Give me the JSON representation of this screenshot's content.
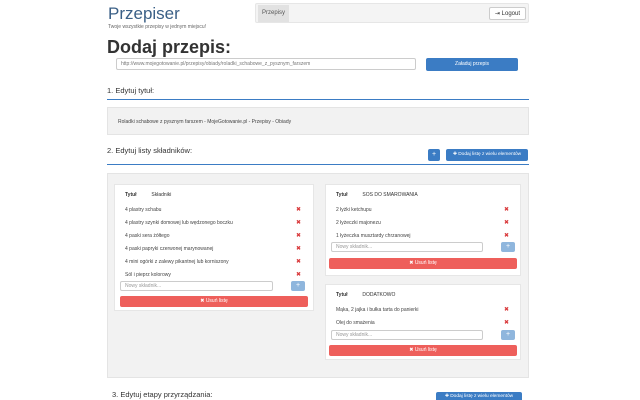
{
  "brand": {
    "title": "Przepiser",
    "subtitle": "Twoje wszystkie przepisy w jednym miejscu!"
  },
  "nav": {
    "tab_label": "Przepisy",
    "logout_label": "Logout"
  },
  "page": {
    "title": "Dodaj przepis:",
    "url_value": "http://www.mojegotowanie.pl/przepisy/obiady/roladki_schabowe_z_pysznym_farszem",
    "load_button": "Załaduj przepis"
  },
  "section1": {
    "title": "1. Edytuj tytuł:",
    "value": "Roladki schabowe z pysznym farszem - MojeGotowanie.pl - Przepisy - Obiady"
  },
  "section2": {
    "title": "2. Edytuj listy składników:",
    "add_button": "+",
    "add_list_button": "Dodaj listę z wielu elementów"
  },
  "section3": {
    "title": "3. Edytuj etapy przyrządzania:",
    "add_list_button": "Dodaj listę z wielu elementów"
  },
  "common": {
    "title_label": "Tytuł",
    "new_ingredient_placeholder": "Nowy składnik...",
    "add_button": "+",
    "delete_icon": "✖",
    "delete_list": "Usuń listę"
  },
  "lists": [
    {
      "name": "Składniki",
      "items": [
        "4 plastry schabu",
        "4 plastry szynki domowej lub wędzonego boczku",
        "4 paski sera żółtego",
        "4 paski papryki czerwonej marynowanej",
        "4 mini ogórki z zalewy pikantnej lub korniszony",
        "Sól i pieprz kolorowy"
      ]
    },
    {
      "name": "SOS DO SMAROWANIA",
      "items": [
        "2 łyżki ketchupu",
        "2 łyżeczki majonezu",
        "1 łyżeczka musztardy chrzanowej"
      ]
    },
    {
      "name": "DODATKOWO",
      "items": [
        "Mąka, 2 jajka i bułka tarta do panierki",
        "Olej do smażenia"
      ]
    }
  ],
  "colors": {
    "brand": "#3a5f86",
    "primary": "#3b7cc4",
    "danger": "#ee5f5b",
    "delete_icon": "#d9383a"
  }
}
